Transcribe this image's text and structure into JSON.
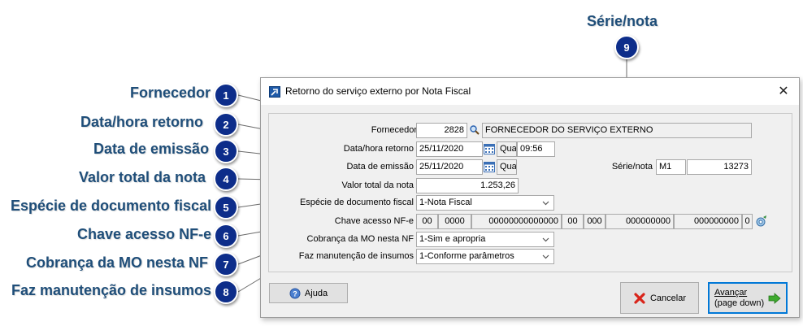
{
  "callouts": [
    {
      "num": "1",
      "label": "Fornecedor"
    },
    {
      "num": "2",
      "label": "Data/hora retorno"
    },
    {
      "num": "3",
      "label": "Data de emissão"
    },
    {
      "num": "4",
      "label": "Valor total da nota"
    },
    {
      "num": "5",
      "label": "Espécie de documento fiscal"
    },
    {
      "num": "6",
      "label": "Chave acesso NF-e"
    },
    {
      "num": "7",
      "label": "Cobrança da MO nesta NF"
    },
    {
      "num": "8",
      "label": "Faz manutenção de insumos"
    },
    {
      "num": "9",
      "label": "Série/nota"
    }
  ],
  "window": {
    "title": "Retorno do serviço externo por Nota Fiscal",
    "close_glyph": "✕"
  },
  "form": {
    "fornecedor": {
      "label": "Fornecedor",
      "code": "2828",
      "name": "FORNECEDOR DO SERVIÇO EXTERNO"
    },
    "data_hora_retorno": {
      "label": "Data/hora retorno",
      "date": "25/11/2020",
      "weekday": "Qua",
      "time": "09:56"
    },
    "data_emissao": {
      "label": "Data de emissão",
      "date": "25/11/2020",
      "weekday": "Qua"
    },
    "serie_nota": {
      "label": "Série/nota",
      "serie": "M1",
      "nota": "13273"
    },
    "valor_total": {
      "label": "Valor total da nota",
      "value": "1.253,26"
    },
    "especie": {
      "label": "Espécie de documento fiscal",
      "value": "1-Nota Fiscal"
    },
    "chave": {
      "label": "Chave acesso NF-e",
      "parts": [
        "00",
        "0000",
        "00000000000000",
        "00",
        "000",
        "000000000",
        "000000000",
        "0"
      ]
    },
    "cobranca": {
      "label": "Cobrança da MO nesta NF",
      "value": "1-Sim e apropria"
    },
    "manutencao": {
      "label": "Faz manutenção de insumos",
      "value": "1-Conforme parâmetros"
    }
  },
  "buttons": {
    "ajuda": "Ajuda",
    "cancelar": "Cancelar",
    "avancar_line1": "Avançar",
    "avancar_line2": "(page down)"
  },
  "colors": {
    "badge": "#0d2d8a",
    "callout_text": "#1f4e79",
    "focus": "#0078d7"
  }
}
